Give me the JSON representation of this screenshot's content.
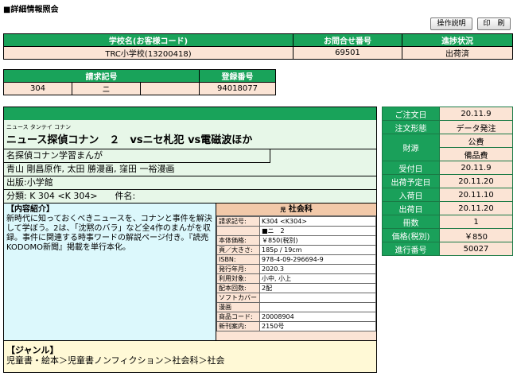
{
  "page_title": "■詳細情報照会",
  "buttons": {
    "help": "操作説明",
    "print": "印　刷"
  },
  "summary_table": {
    "headers": {
      "school": "学校名(お客様コード)",
      "inquiry": "お問合せ番号",
      "status": "進捗状況"
    },
    "values": {
      "school": "TRC小学校(13200418)",
      "inquiry": "69501",
      "status": "出荷済"
    }
  },
  "request_table": {
    "headers": {
      "request_code": "請求記号",
      "registration": "登録番号"
    },
    "values": {
      "request_col1": "304",
      "request_col2": "ニ",
      "request_col3": "",
      "registration": "94018077"
    }
  },
  "book": {
    "series_kana": "ニュース タンテイ コナン",
    "title": "ニュース探偵コナン　２　vsニセ札犯 vs電磁波ほか",
    "subtitle": "名探偵コナン学習まんが",
    "authors": "青山 剛昌原作, 太田 勝漫画, 窪田 一裕漫画",
    "publisher": "出版:小学館",
    "classification": "分類: K 304 <K 304>　　件名:",
    "content_label": "【内容紹介】",
    "content_text": "新時代に知っておくべきニュースを、コナンと事件を解決して学ぼう。2は、「沈黙のバラ」など全4作のまんがを収録。事件に関連する時事ワードの解説ページ付き。『読売KODOMO新聞』掲載を単行本化。",
    "genre_label": "【ジャンル】",
    "genre_text": "児童書・絵本＞児童書ノンフィクション＞社会科＞社会"
  },
  "detail": {
    "category_mark": "児",
    "category": "社会科",
    "rows": [
      {
        "label": "請求記号:",
        "value": "K304 <K304>"
      },
      {
        "label": "",
        "value": "■ニ　2"
      },
      {
        "label": "本体価格:",
        "value": "￥850(税別)"
      },
      {
        "label": "頁／大きさ:",
        "value": "185p / 19cm"
      },
      {
        "label": "ISBN:",
        "value": "978-4-09-296694-9"
      },
      {
        "label": "発行年月:",
        "value": "2020.3"
      },
      {
        "label": "利用対象:",
        "value": "小中, 小上"
      },
      {
        "label": "配本回数:",
        "value": "2配"
      },
      {
        "label": "ソフトカバー",
        "value": ""
      },
      {
        "label": "漫画",
        "value": ""
      },
      {
        "label": "商品コード:",
        "value": "20008904"
      },
      {
        "label": "新刊案内:",
        "value": "2150号"
      }
    ]
  },
  "order_info": {
    "order_date_label": "ご注文日",
    "order_date": "20.11.9",
    "order_type_label": "注文形態",
    "order_type": "データ発注",
    "funding_label": "財源",
    "funding_1": "公費",
    "funding_2": "備品費",
    "received_label": "受付日",
    "received": "20.11.9",
    "ship_plan_label": "出荷予定日",
    "ship_plan": "20.11.20",
    "arrival_label": "入荷日",
    "arrival": "20.11.10",
    "shipped_label": "出荷日",
    "shipped": "20.11.20",
    "quantity_label": "冊数",
    "quantity": "1",
    "price_label": "価格(税別)",
    "price": "￥850",
    "progress_no_label": "進行番号",
    "progress_no": "50027"
  },
  "colors": {
    "header_green": "#19a35a",
    "pink": "#fbe4d5",
    "mint": "#e7f7e8",
    "cream": "#fff9d6",
    "detail_header": "#f2c9a9"
  }
}
